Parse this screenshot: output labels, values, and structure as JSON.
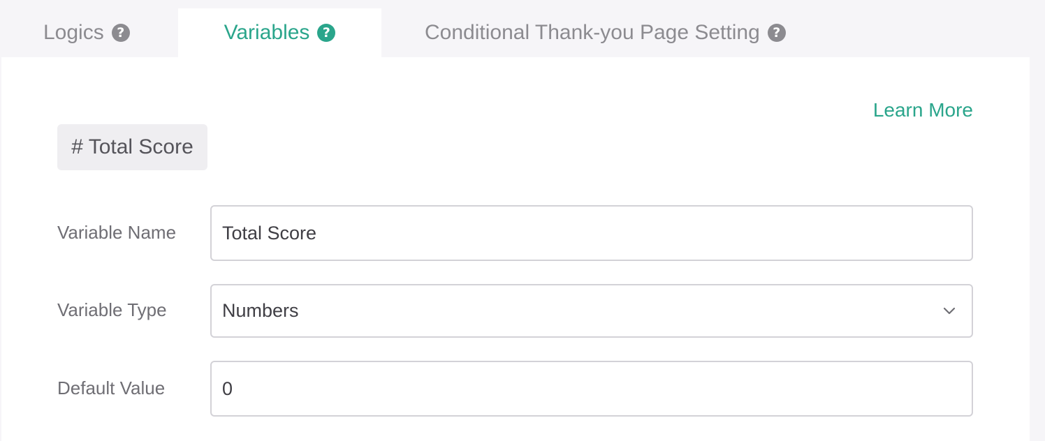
{
  "tabs": [
    {
      "label": "Logics",
      "icon": "question-circle-icon",
      "active": false
    },
    {
      "label": "Variables",
      "icon": "question-circle-icon",
      "active": true
    },
    {
      "label": "Conditional Thank-you Page Setting",
      "icon": "question-circle-icon",
      "active": false
    }
  ],
  "help_glyph": "?",
  "learn_more": "Learn More",
  "variable_chip": "# Total Score",
  "form": {
    "name_label": "Variable Name",
    "name_value": "Total Score",
    "type_label": "Variable Type",
    "type_value": "Numbers",
    "default_label": "Default Value",
    "default_value": "0"
  },
  "colors": {
    "accent": "#2aa58b",
    "muted_text": "#8c8b90",
    "background": "#f6f5f8"
  }
}
